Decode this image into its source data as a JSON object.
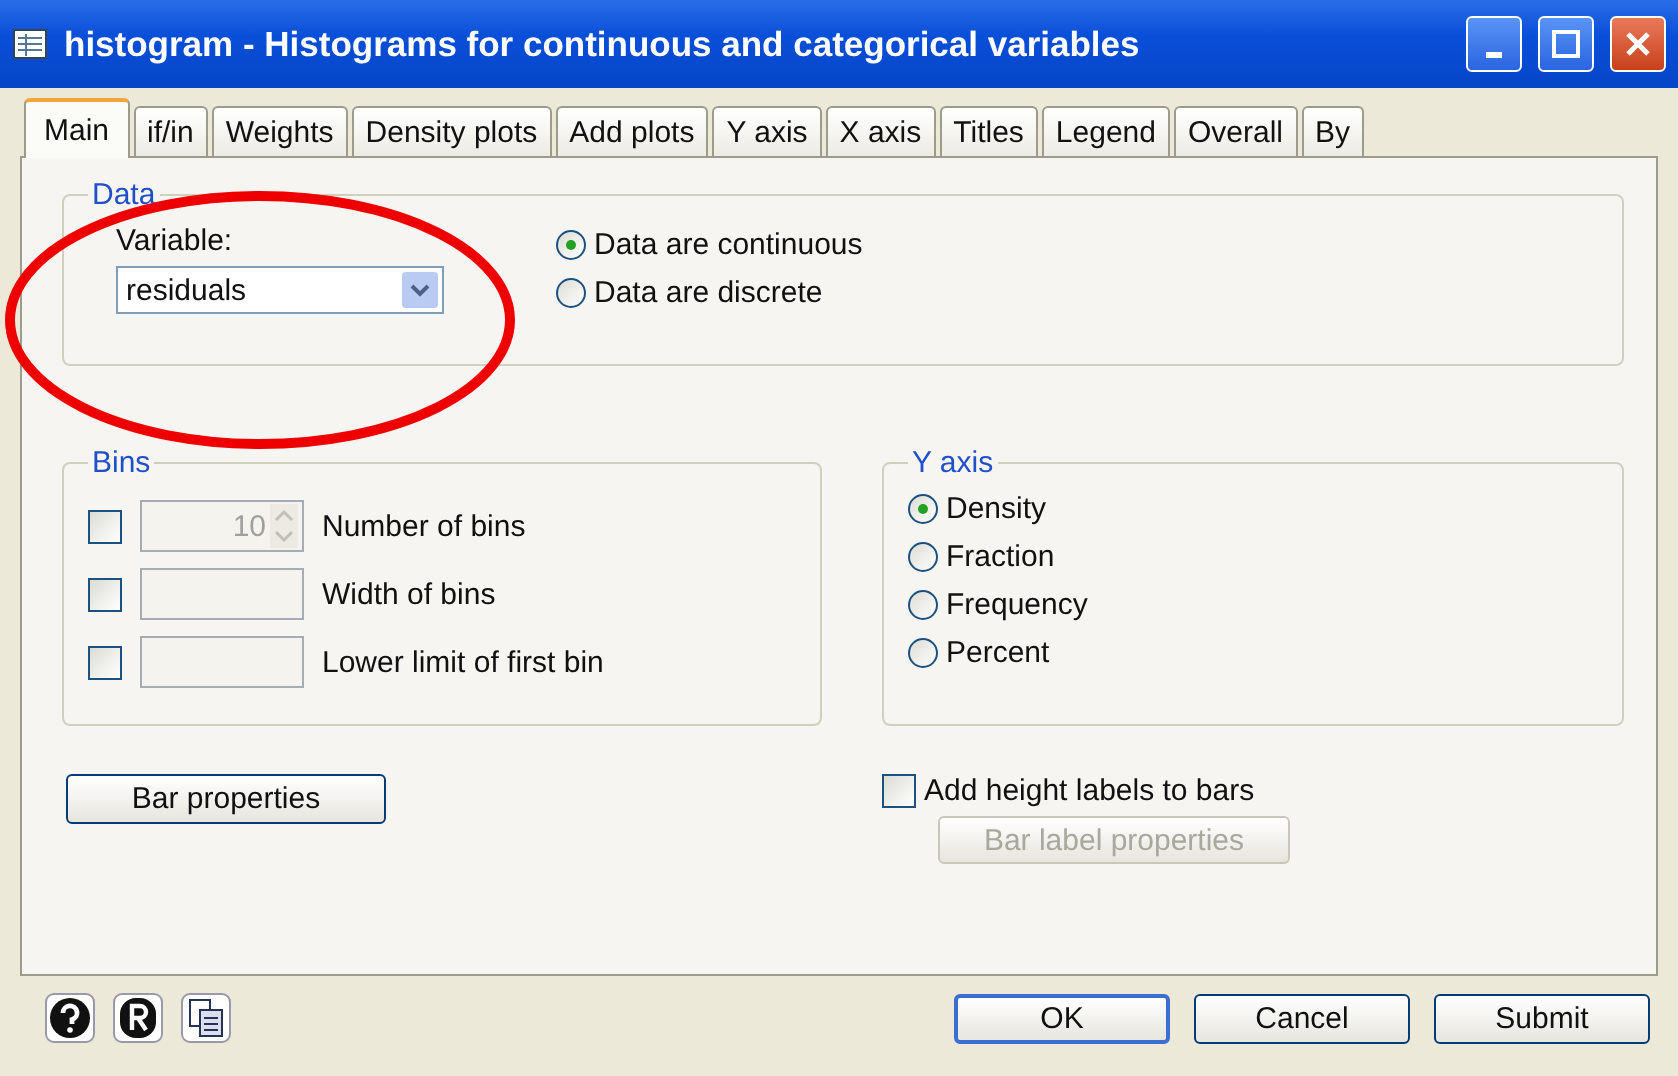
{
  "window": {
    "title": "histogram - Histograms for continuous and categorical variables"
  },
  "tabs": [
    {
      "label": "Main",
      "selected": true
    },
    {
      "label": "if/in",
      "selected": false
    },
    {
      "label": "Weights",
      "selected": false
    },
    {
      "label": "Density plots",
      "selected": false
    },
    {
      "label": "Add plots",
      "selected": false
    },
    {
      "label": "Y axis",
      "selected": false
    },
    {
      "label": "X axis",
      "selected": false
    },
    {
      "label": "Titles",
      "selected": false
    },
    {
      "label": "Legend",
      "selected": false
    },
    {
      "label": "Overall",
      "selected": false
    },
    {
      "label": "By",
      "selected": false
    }
  ],
  "data_group": {
    "title": "Data",
    "variable_label": "Variable:",
    "variable_value": "residuals",
    "options": [
      {
        "label": "Data are continuous",
        "selected": true
      },
      {
        "label": "Data are discrete",
        "selected": false
      }
    ]
  },
  "bins_group": {
    "title": "Bins",
    "rows": [
      {
        "kind": "spinner",
        "checked": false,
        "value": "10",
        "label": "Number of bins"
      },
      {
        "kind": "field",
        "checked": false,
        "label": "Width of bins"
      },
      {
        "kind": "field",
        "checked": false,
        "label": "Lower limit of first bin"
      }
    ]
  },
  "y_axis_group": {
    "title": "Y axis",
    "options": [
      {
        "label": "Density",
        "selected": true
      },
      {
        "label": "Fraction",
        "selected": false
      },
      {
        "label": "Frequency",
        "selected": false
      },
      {
        "label": "Percent",
        "selected": false
      }
    ]
  },
  "bar_properties_button": {
    "label": "Bar properties"
  },
  "height_labels": {
    "label": "Add height labels to bars",
    "checked": false
  },
  "bar_label_properties_button": {
    "label": "Bar label properties",
    "disabled": true
  },
  "buttons": [
    {
      "label": "OK",
      "default": true
    },
    {
      "label": "Cancel",
      "default": false
    },
    {
      "label": "Submit",
      "default": false
    }
  ]
}
